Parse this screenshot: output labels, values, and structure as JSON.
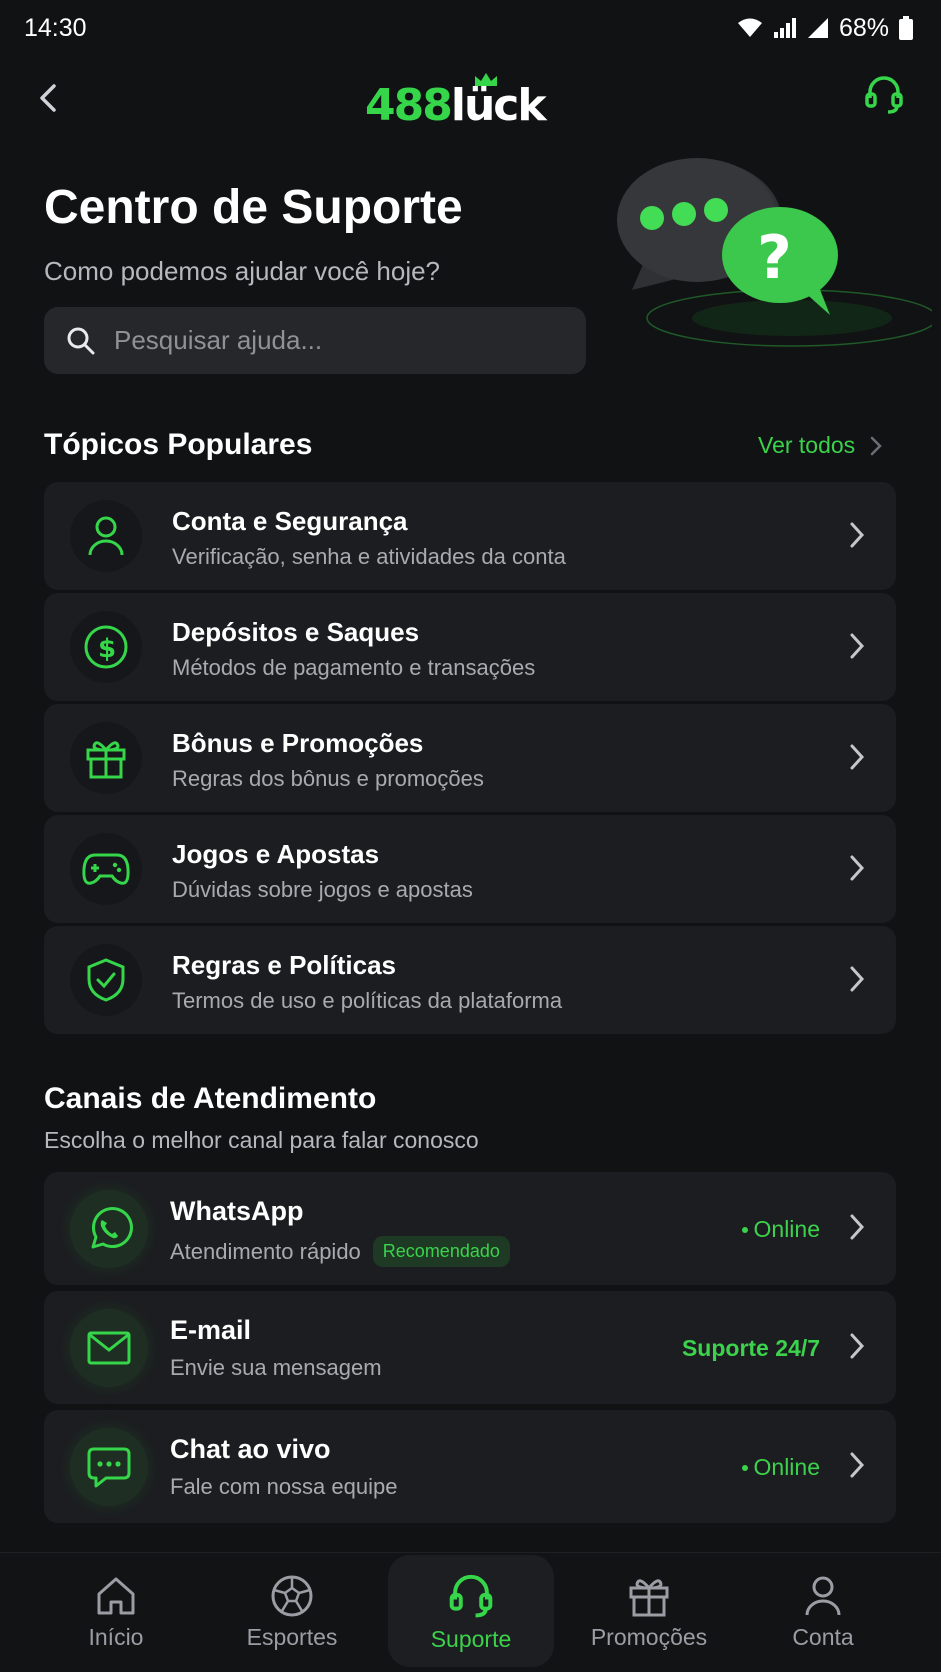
{
  "status_bar": {
    "time": "14:30",
    "battery": "68%"
  },
  "header": {
    "logo_num": "488",
    "logo_word": "lück"
  },
  "hero": {
    "title": "Centro de Suporte",
    "subtitle": "Como podemos ajudar você hoje?",
    "search_placeholder": "Pesquisar ajuda..."
  },
  "popular": {
    "title": "Tópicos Populares",
    "see_all": "Ver todos",
    "items": [
      {
        "title": "Conta e Segurança",
        "subtitle": "Verificação, senha e atividades da conta",
        "icon": "user-icon"
      },
      {
        "title": "Depósitos e Saques",
        "subtitle": "Métodos de pagamento e transações",
        "icon": "dollar-icon"
      },
      {
        "title": "Bônus e Promoções",
        "subtitle": "Regras dos bônus e promoções",
        "icon": "gift-icon"
      },
      {
        "title": "Jogos e Apostas",
        "subtitle": "Dúvidas sobre jogos e apostas",
        "icon": "gamepad-icon"
      },
      {
        "title": "Regras e Políticas",
        "subtitle": "Termos de uso e políticas da plataforma",
        "icon": "shield-icon"
      }
    ]
  },
  "channels": {
    "title": "Canais de Atendimento",
    "subtitle": "Escolha o melhor canal para falar conosco",
    "items": [
      {
        "title": "WhatsApp",
        "subtitle": "Atendimento rápido",
        "badge": "Recomendado",
        "status": "Online",
        "icon": "whatsapp-icon"
      },
      {
        "title": "E-mail",
        "subtitle": "Envie sua mensagem",
        "status": "Suporte 24/7",
        "icon": "mail-icon"
      },
      {
        "title": "Chat ao vivo",
        "subtitle": "Fale com nossa equipe",
        "status": "Online",
        "icon": "chat-icon"
      }
    ]
  },
  "tabs": [
    {
      "label": "Início",
      "icon": "home-icon"
    },
    {
      "label": "Esportes",
      "icon": "soccer-ball-icon"
    },
    {
      "label": "Suporte",
      "icon": "headset-icon",
      "active": true
    },
    {
      "label": "Promoções",
      "icon": "gift-icon"
    },
    {
      "label": "Conta",
      "icon": "user-icon"
    }
  ],
  "colors": {
    "accent": "#35d64a",
    "background": "#111214",
    "card": "#1c1d20"
  }
}
